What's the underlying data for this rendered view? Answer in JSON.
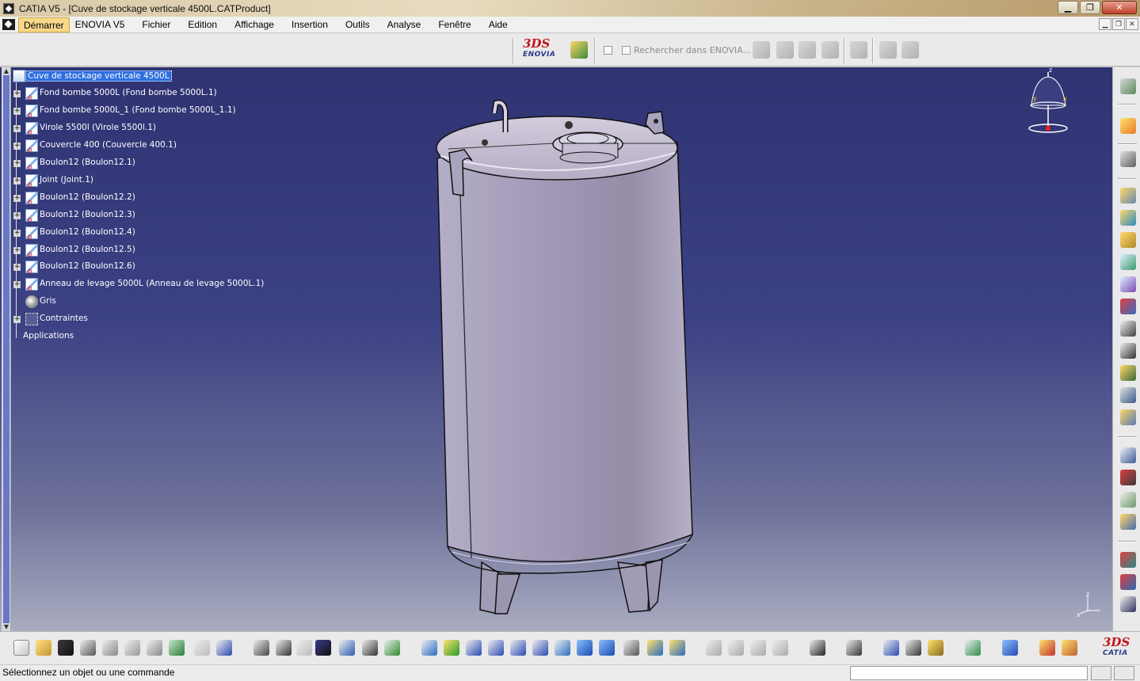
{
  "window": {
    "title": "CATIA V5 - [Cuve de stockage verticale 4500L.CATProduct]",
    "controls": [
      "minimize",
      "maximize",
      "close"
    ]
  },
  "menubar": {
    "items": [
      "Démarrer",
      "ENOVIA V5",
      "Fichier",
      "Edition",
      "Affichage",
      "Insertion",
      "Outils",
      "Analyse",
      "Fenêtre",
      "Aide"
    ],
    "active_index": 0
  },
  "toolbar_top": {
    "logo_ds": "3DS",
    "logo_enovia": "ENOVIA",
    "search_label": "Rechercher dans ENOVIA..."
  },
  "tree": {
    "root": "Cuve de stockage verticale 4500L",
    "children": [
      {
        "label": "Fond bombe 5000L (Fond bombe 5000L.1)",
        "kind": "part"
      },
      {
        "label": "Fond bombe 5000L_1 (Fond bombe 5000L_1.1)",
        "kind": "part"
      },
      {
        "label": "Virole 5500l (Virole 5500l.1)",
        "kind": "part"
      },
      {
        "label": "Couvercle 400 (Couvercle 400.1)",
        "kind": "part"
      },
      {
        "label": "Boulon12 (Boulon12.1)",
        "kind": "part"
      },
      {
        "label": "Joint (Joint.1)",
        "kind": "part"
      },
      {
        "label": "Boulon12 (Boulon12.2)",
        "kind": "part"
      },
      {
        "label": "Boulon12 (Boulon12.3)",
        "kind": "part"
      },
      {
        "label": "Boulon12 (Boulon12.4)",
        "kind": "part"
      },
      {
        "label": "Boulon12 (Boulon12.5)",
        "kind": "part"
      },
      {
        "label": "Boulon12 (Boulon12.6)",
        "kind": "part"
      },
      {
        "label": "Anneau de levage 5000L (Anneau de levage 5000L.1)",
        "kind": "part"
      },
      {
        "label": "Gris",
        "kind": "material"
      },
      {
        "label": "Contraintes",
        "kind": "constraints"
      }
    ],
    "applications": "Applications"
  },
  "compass": {
    "x": "x",
    "y": "y",
    "z": "z"
  },
  "status": {
    "message": "Sélectionnez un objet ou une commande",
    "command_input": ""
  },
  "brand_bottom": {
    "ds": "3DS",
    "catia": "CATIA"
  }
}
